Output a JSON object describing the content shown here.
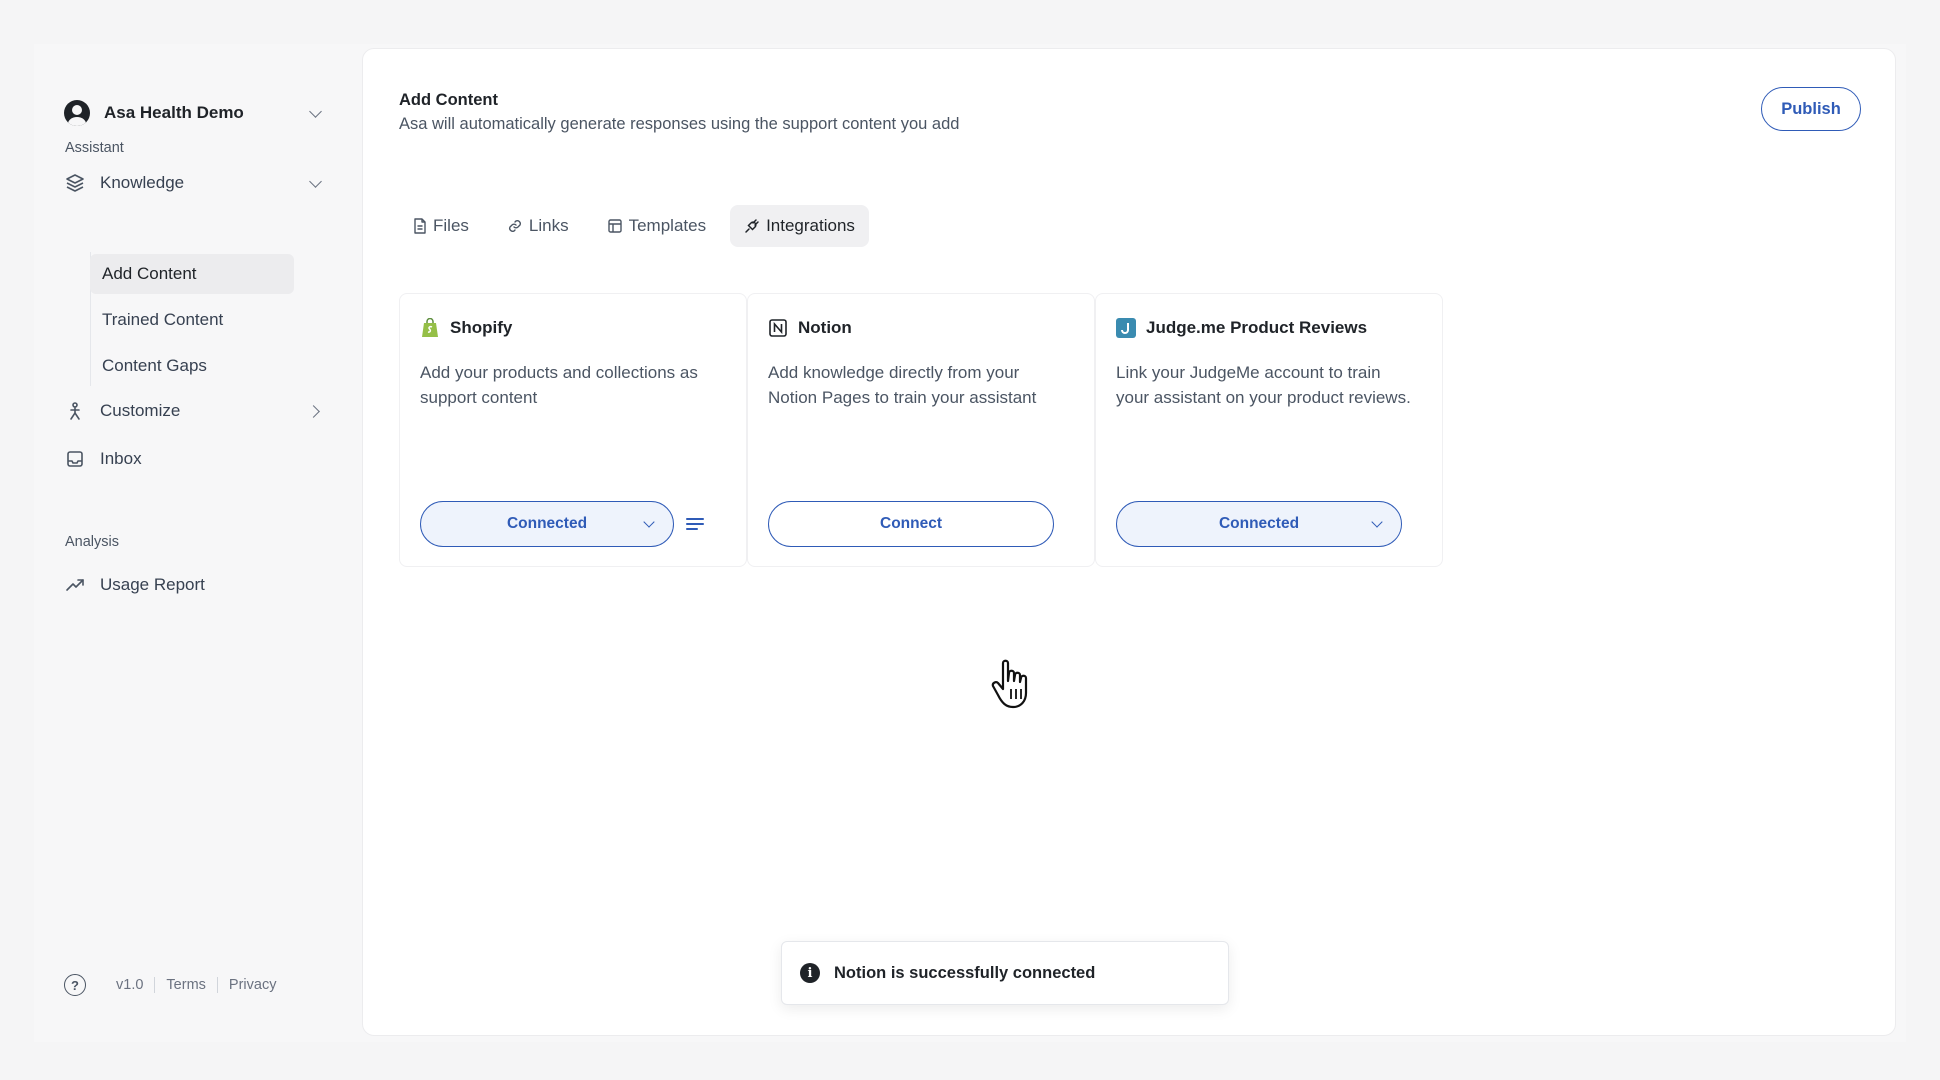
{
  "sidebar": {
    "workspace": "Asa Health Demo",
    "sections": {
      "assistant": "Assistant",
      "analysis": "Analysis"
    },
    "items": {
      "knowledge": "Knowledge",
      "customize": "Customize",
      "inbox": "Inbox",
      "usage_report": "Usage Report"
    },
    "knowledge_sub": [
      "Add Content",
      "Trained Content",
      "Content Gaps"
    ],
    "footer": {
      "version": "v1.0",
      "terms": "Terms",
      "privacy": "Privacy"
    }
  },
  "header": {
    "title": "Add Content",
    "subtitle": "Asa will automatically generate responses using the support content you add",
    "publish_label": "Publish"
  },
  "tabs": [
    "Files",
    "Links",
    "Templates",
    "Integrations"
  ],
  "active_tab": "Integrations",
  "integrations": [
    {
      "name": "Shopify",
      "description": "Add your products and collections as support content",
      "status": "Connected"
    },
    {
      "name": "Notion",
      "description": "Add knowledge directly from your Notion Pages to train your assistant",
      "status": "Connect"
    },
    {
      "name": "Judge.me Product Reviews",
      "description": "Link your JudgeMe account to train your assistant on your product reviews.",
      "status": "Connected"
    }
  ],
  "toast": {
    "message": "Notion is successfully connected"
  },
  "colors": {
    "accent": "#2f5bb7",
    "shopify_green": "#95bf47",
    "judgeme_teal": "#3a8bb0"
  },
  "icons": {
    "shopify": "shopify-bag-icon",
    "notion": "notion-n-icon",
    "judgeme": "judgeme-j-icon"
  }
}
